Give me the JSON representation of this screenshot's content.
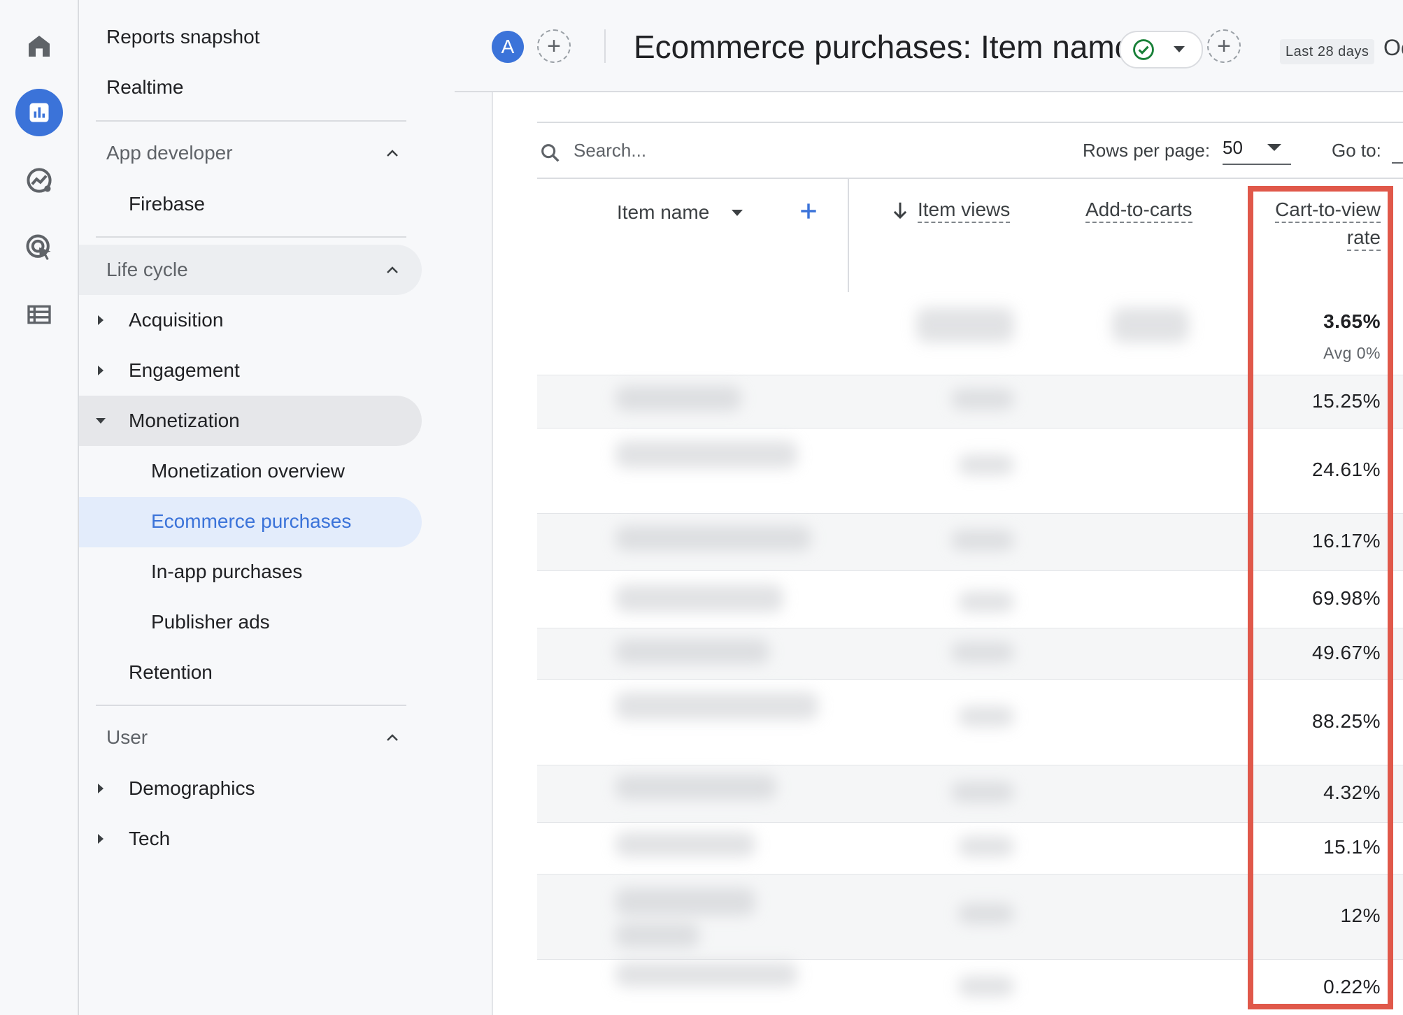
{
  "rail": {
    "items": [
      {
        "icon": "home-icon",
        "active": false
      },
      {
        "icon": "reports-icon",
        "active": true
      },
      {
        "icon": "explore-icon",
        "active": false
      },
      {
        "icon": "advertising-icon",
        "active": false
      },
      {
        "icon": "configure-icon",
        "active": false
      }
    ],
    "accent": "#3b73d9"
  },
  "nav": {
    "reports_snapshot": "Reports snapshot",
    "realtime": "Realtime",
    "app_developer": "App developer",
    "firebase": "Firebase",
    "life_cycle": "Life cycle",
    "acquisition": "Acquisition",
    "engagement": "Engagement",
    "monetization": "Monetization",
    "monetization_overview": "Monetization overview",
    "ecommerce_purchases": "Ecommerce purchases",
    "in_app_purchases": "In-app purchases",
    "publisher_ads": "Publisher ads",
    "retention": "Retention",
    "user": "User",
    "demographics": "Demographics",
    "tech": "Tech"
  },
  "header": {
    "avatar_letter": "A",
    "title": "Ecommerce purchases: Item name",
    "date_range": "Last 28 days",
    "date_range_cut": "Oc"
  },
  "toolbar": {
    "search_placeholder": "Search...",
    "rows_per_page_label": "Rows per page:",
    "rows_per_page_value": "50",
    "goto_label": "Go to:"
  },
  "table": {
    "columns": {
      "item_name": "Item name",
      "item_views": "Item views",
      "add_to_carts": "Add-to-carts",
      "cart_to_view_line1": "Cart-to-view",
      "cart_to_view_line2": "rate"
    },
    "total": {
      "value": "3.65%",
      "avg": "Avg 0%"
    },
    "rows": [
      "15.25%",
      "24.61%",
      "16.17%",
      "69.98%",
      "49.67%",
      "88.25%",
      "4.32%",
      "15.1%",
      "12%",
      "0.22%"
    ]
  },
  "colors": {
    "highlight_box": "#e0584a",
    "link_blue": "#3b73d9",
    "selected_bg": "#e3ecfb"
  }
}
